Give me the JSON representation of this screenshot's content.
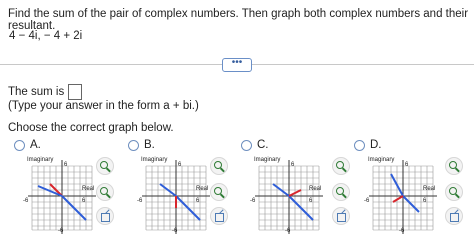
{
  "question": "Find the sum of the pair of complex numbers. Then graph both complex numbers and their resultant.",
  "expression": "4 − 4i,  − 4 + 2i",
  "more_button": "•••",
  "answer": {
    "prefix": "The sum is",
    "value": "",
    "hint": "(Type your answer in the form a + bi.)"
  },
  "choose_label": "Choose the correct graph below.",
  "options": [
    {
      "letter": "A.",
      "selected": false
    },
    {
      "letter": "B.",
      "selected": false
    },
    {
      "letter": "C.",
      "selected": false
    },
    {
      "letter": "D.",
      "selected": false
    }
  ],
  "graph_labels": {
    "imaginary": "Imaginary",
    "real": "Real",
    "tick_pos": "6",
    "tick_neg": "-6"
  },
  "colors": {
    "grid": "#999999",
    "axis": "#333333",
    "blue": "#2f5ed8",
    "red": "#d8262d",
    "zoom": "#2f7b35"
  },
  "icons": [
    "zoom-in-icon",
    "zoom-out-icon",
    "open-external-icon"
  ]
}
